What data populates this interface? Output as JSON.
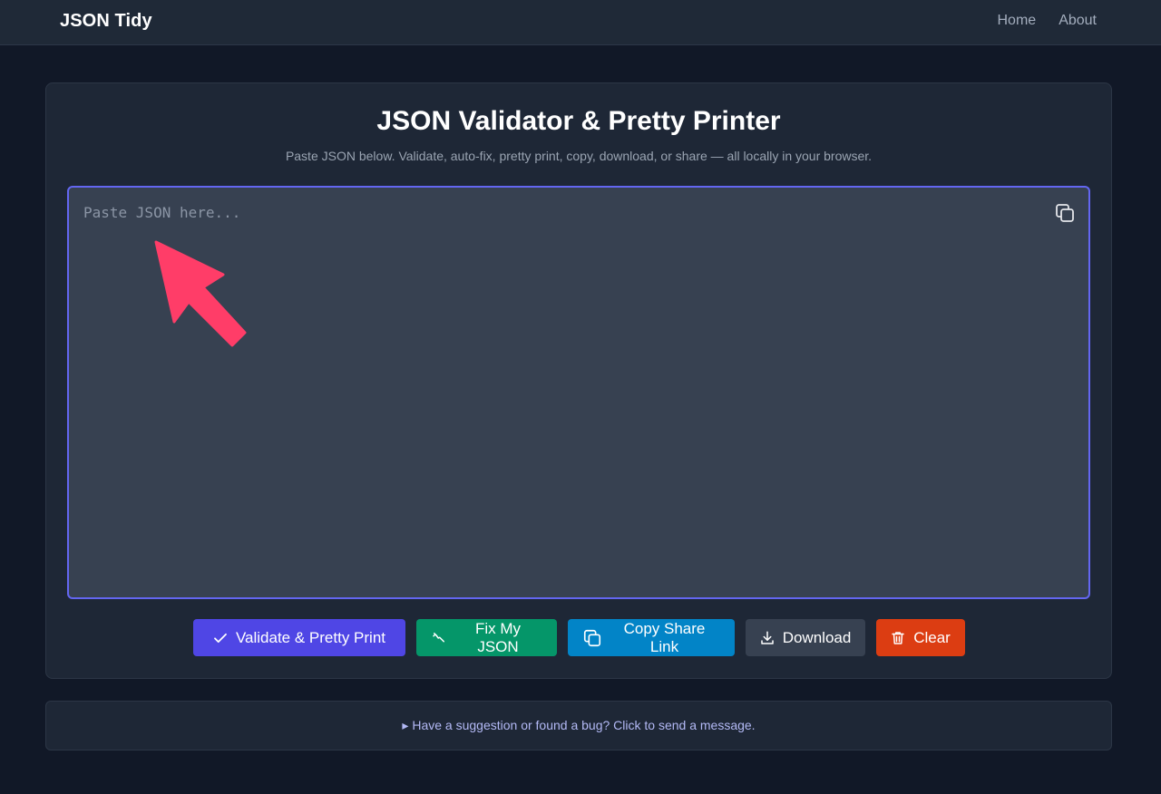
{
  "navbar": {
    "brand": "JSON Tidy",
    "links": [
      {
        "label": "Home"
      },
      {
        "label": "About"
      }
    ]
  },
  "main": {
    "title": "JSON Validator & Pretty Printer",
    "subtitle": "Paste JSON below. Validate, auto-fix, pretty print, copy, download, or share — all locally in your browser.",
    "editor": {
      "placeholder": "Paste JSON here...",
      "value": "",
      "border_color": "#6366f1"
    },
    "buttons": {
      "validate": {
        "label": "Validate & Pretty Print",
        "icon": "check-icon",
        "color": "#4f46e5"
      },
      "fix": {
        "label": "Fix My JSON",
        "icon": "wrench-icon",
        "color": "#059669"
      },
      "share": {
        "label": "Copy Share Link",
        "icon": "copy-icon",
        "color": "#0284c7"
      },
      "download": {
        "label": "Download",
        "icon": "download-icon",
        "color": "#374151"
      },
      "clear": {
        "label": "Clear",
        "icon": "trash-icon",
        "color": "#dc3d12"
      }
    }
  },
  "feedback": {
    "toggle_label": "▸ Have a suggestion or found a bug? Click to send a message."
  },
  "annotation": {
    "icon": "pointer-arrow-icon",
    "color": "#ff3d68"
  }
}
